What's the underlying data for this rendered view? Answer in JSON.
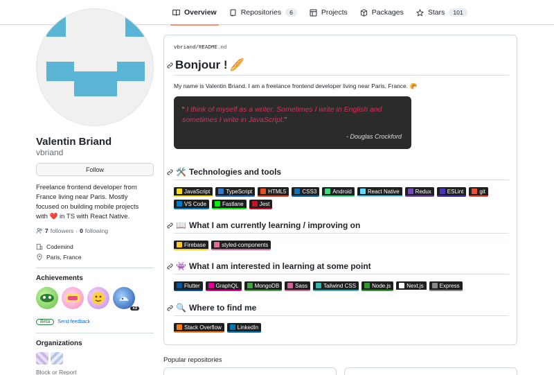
{
  "nav": {
    "tabs": [
      {
        "label": "Overview",
        "icon": "book-icon",
        "active": true
      },
      {
        "label": "Repositories",
        "icon": "repo-icon",
        "count": "6"
      },
      {
        "label": "Projects",
        "icon": "table-icon"
      },
      {
        "label": "Packages",
        "icon": "package-icon"
      },
      {
        "label": "Stars",
        "icon": "star-icon",
        "count": "101"
      }
    ]
  },
  "profile": {
    "full_name": "Valentin Briand",
    "username": "vbriand",
    "follow_label": "Follow",
    "bio_1": "Freelance frontend developer from France living near Paris. Mostly focused on building mobile projects with",
    "bio_heart": "❤️",
    "bio_2": "in TS with React Native.",
    "followers_count": "7",
    "followers_label": "followers",
    "dot": "·",
    "following_count": "0",
    "following_label": "following",
    "company": "Codemind",
    "location": "Paris, France",
    "achievements_title": "Achievements",
    "achievement_multiplier": "x3",
    "beta_label": "Beta",
    "feedback_label": "Send feedback",
    "organizations_title": "Organizations",
    "block_label": "Block or Report"
  },
  "readme": {
    "path_user": "vbriand",
    "path_sep": "/",
    "path_file": "README",
    "path_ext": ".md",
    "title": "Bonjour !",
    "title_emoji": "🥖",
    "intro": "My name is Valentin Briand. I am a freelance frontend developer living near Paris, France. 🥐",
    "quote_open": "“",
    "quote_text": "I think of myself as a writer. Sometimes I write in English and sometimes I write in JavaScript.",
    "quote_close": "”",
    "quote_author": "- Douglas Crockford",
    "sections": [
      {
        "emoji": "🛠️",
        "title": "Technologies and tools",
        "badges": [
          {
            "label": "JavaScript",
            "color": "#f7df1e"
          },
          {
            "label": "TypeScript",
            "color": "#3178c6"
          },
          {
            "label": "HTML5",
            "color": "#e34f26"
          },
          {
            "label": "CSS3",
            "color": "#1572b6"
          },
          {
            "label": "Android",
            "color": "#3ddc84"
          },
          {
            "label": "React Native",
            "color": "#61dafb"
          },
          {
            "label": "Redux",
            "color": "#764abc"
          },
          {
            "label": "ESLint",
            "color": "#4b32c3"
          },
          {
            "label": "git",
            "color": "#f05032"
          },
          {
            "label": "VS Code",
            "color": "#007acc"
          },
          {
            "label": "Fastlane",
            "color": "#00f200"
          },
          {
            "label": "Jest",
            "color": "#c21325"
          }
        ]
      },
      {
        "emoji": "📖",
        "title": "What I am currently learning / improving on",
        "badges": [
          {
            "label": "Firebase",
            "color": "#ffca28"
          },
          {
            "label": "styled-components",
            "color": "#db7093"
          }
        ]
      },
      {
        "emoji": "👾",
        "title": "What I am interested in learning at some point",
        "badges": [
          {
            "label": "Flutter",
            "color": "#02569b"
          },
          {
            "label": "GraphQL",
            "color": "#e10098"
          },
          {
            "label": "MongoDB",
            "color": "#47a248"
          },
          {
            "label": "Sass",
            "color": "#cc6699"
          },
          {
            "label": "Tailwind CSS",
            "color": "#38b2ac"
          },
          {
            "label": "Node.js",
            "color": "#339933"
          },
          {
            "label": "Next.js",
            "color": "#ffffff"
          },
          {
            "label": "Express",
            "color": "#888888"
          }
        ]
      },
      {
        "emoji": "🔍",
        "title": "Where to find me",
        "badges": [
          {
            "label": "Stack Overflow",
            "color": "#fe7a16"
          },
          {
            "label": "LinkedIn",
            "color": "#0077b5"
          }
        ]
      }
    ]
  },
  "popular_title": "Popular repositories",
  "colors": {
    "accent": "#fd8c73",
    "link": "#0969da",
    "avatar": "#5ab4d6"
  }
}
